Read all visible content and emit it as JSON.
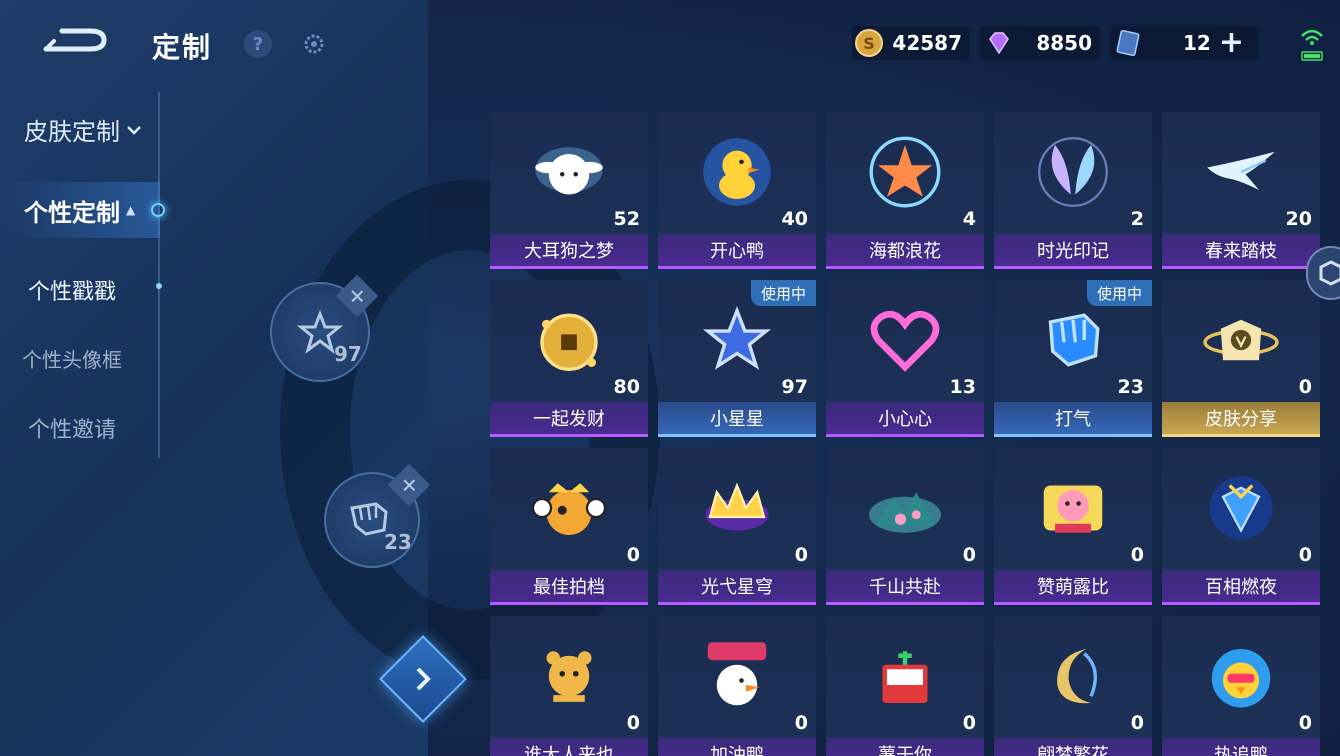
{
  "header": {
    "title": "定制",
    "help_label": "?"
  },
  "sidebar": {
    "category": "皮肤定制",
    "items": [
      {
        "label": "个性定制"
      },
      {
        "label": "个性戳戳"
      },
      {
        "label": "个性头像框"
      },
      {
        "label": "个性邀请"
      }
    ]
  },
  "equipped": {
    "slot1_count": "97",
    "slot2_count": "23"
  },
  "currency": {
    "gold": "42587",
    "gems": "8850",
    "tickets": "12",
    "plus_label": "+"
  },
  "items": [
    {
      "name": "大耳狗之梦",
      "count": "52",
      "icon": "cinnamoroll-icon"
    },
    {
      "name": "开心鸭",
      "count": "40",
      "icon": "duck-icon"
    },
    {
      "name": "海都浪花",
      "count": "4",
      "icon": "starfish-icon"
    },
    {
      "name": "时光印记",
      "count": "2",
      "icon": "wings-icon"
    },
    {
      "name": "春来踏枝",
      "count": "20",
      "icon": "swallow-icon"
    },
    {
      "name": "一起发财",
      "count": "80",
      "icon": "coin-icon"
    },
    {
      "name": "小星星",
      "count": "97",
      "icon": "star-icon",
      "badge": "使用中"
    },
    {
      "name": "小心心",
      "count": "13",
      "icon": "heart-icon"
    },
    {
      "name": "打气",
      "count": "23",
      "icon": "fist-icon",
      "badge": "使用中"
    },
    {
      "name": "皮肤分享",
      "count": "0",
      "icon": "share-icon"
    },
    {
      "name": "最佳拍档",
      "count": "0",
      "icon": "partner-icon"
    },
    {
      "name": "光弋星穹",
      "count": "0",
      "icon": "crown-icon"
    },
    {
      "name": "千山共赴",
      "count": "0",
      "icon": "mountain-icon"
    },
    {
      "name": "赞萌露比",
      "count": "0",
      "icon": "ruby-icon"
    },
    {
      "name": "百相燃夜",
      "count": "0",
      "icon": "mask-icon"
    },
    {
      "name": "谁大人来也",
      "count": "0",
      "icon": "bear-icon"
    },
    {
      "name": "加油鸭",
      "count": "0",
      "icon": "cheer-duck-icon"
    },
    {
      "name": "薯于你",
      "count": "0",
      "icon": "book-icon"
    },
    {
      "name": "翩梦繁花",
      "count": "0",
      "icon": "moon-icon"
    },
    {
      "name": "热追鸭",
      "count": "0",
      "icon": "sun-duck-icon"
    }
  ]
}
